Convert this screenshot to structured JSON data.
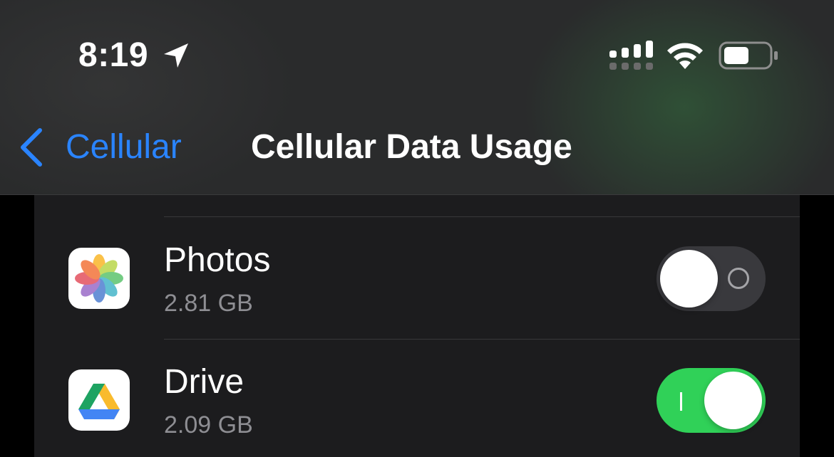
{
  "status_bar": {
    "time": "8:19",
    "icons": [
      "location-arrow-icon",
      "cellular-signal-icon",
      "wifi-icon",
      "battery-icon"
    ]
  },
  "nav": {
    "back_label": "Cellular",
    "title": "Cellular Data Usage"
  },
  "apps": [
    {
      "name": "Photos",
      "usage": "2.81 GB",
      "icon": "photos-app-icon",
      "cellular_enabled": false
    },
    {
      "name": "Drive",
      "usage": "2.09 GB",
      "icon": "drive-app-icon",
      "cellular_enabled": true
    }
  ],
  "colors": {
    "accent": "#2a84ff",
    "toggle_on": "#30d158",
    "toggle_off": "#39393d",
    "list_background": "#1c1c1e",
    "secondary_text": "#8e8e93"
  }
}
